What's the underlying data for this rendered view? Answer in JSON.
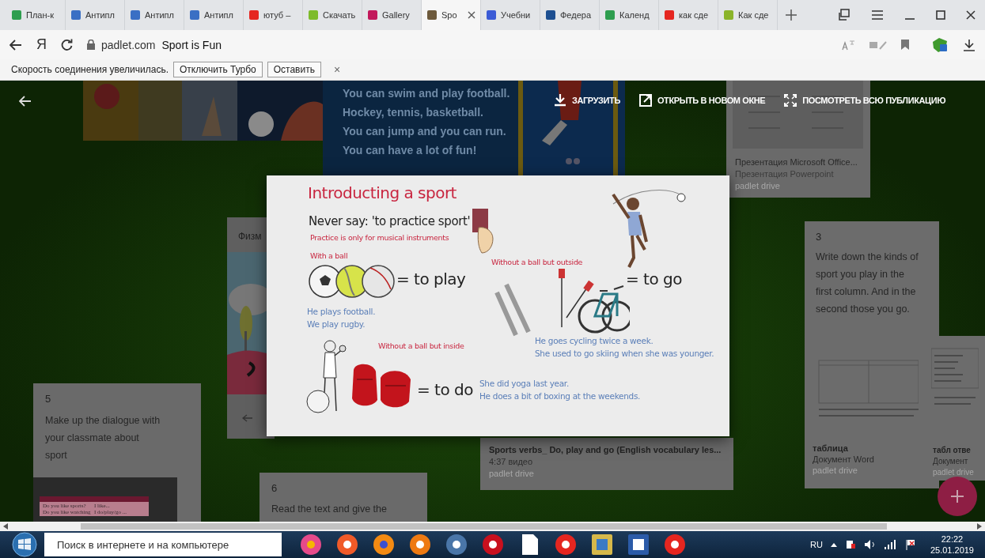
{
  "browser": {
    "tabs": [
      {
        "label": "План-к",
        "selected": false,
        "color": "#2e9e4f"
      },
      {
        "label": "Антипл",
        "selected": false,
        "color": "#3a6fc4"
      },
      {
        "label": "Антипл",
        "selected": false,
        "color": "#3a6fc4"
      },
      {
        "label": "Антипл",
        "selected": false,
        "color": "#3a6fc4"
      },
      {
        "label": "ютуб –",
        "selected": false,
        "color": "#e52620"
      },
      {
        "label": "Скачать",
        "selected": false,
        "color": "#7dbb2a"
      },
      {
        "label": "Gallery",
        "selected": false,
        "color": "#c2185b"
      },
      {
        "label": "Spo",
        "selected": true,
        "color": "#6d5a3c"
      },
      {
        "label": "Учебни",
        "selected": false,
        "color": "#3b5bd6"
      },
      {
        "label": "Федера",
        "selected": false,
        "color": "#1d4f91"
      },
      {
        "label": "Календ",
        "selected": false,
        "color": "#2e9e4f"
      },
      {
        "label": "как сде",
        "selected": false,
        "color": "#e52620"
      },
      {
        "label": "Как сде",
        "selected": false,
        "color": "#8bb42a"
      }
    ],
    "home_glyph": "Я",
    "address": {
      "domain": "padlet.com",
      "title": "Sport is Fun"
    },
    "notification": {
      "text": "Скорость соединения увеличилась.",
      "buttons": [
        "Отключить Турбо",
        "Оставить"
      ],
      "close": "×"
    }
  },
  "viewer": {
    "actions": [
      {
        "kind": "download",
        "label": "ЗАГРУЗИТЬ"
      },
      {
        "kind": "open",
        "label": "ОТКРЫТЬ В НОВОМ ОКНЕ"
      },
      {
        "kind": "fullscreen",
        "label": "ПОСМОТРЕТЬ ВСЮ ПУБЛИКАЦИЮ"
      }
    ]
  },
  "slide": {
    "title": "Introducting a sport",
    "rule": "Never say: 'to practice sport'",
    "note": "Practice is only for musical instruments",
    "groups": [
      {
        "label": "With a ball",
        "verb": "= to play",
        "examples": [
          "He plays football.",
          "We play rugby."
        ]
      },
      {
        "label": "Without a ball but outside",
        "verb": "= to go",
        "examples": [
          "He goes cycling twice a week.",
          "She used to go skiing when she was younger."
        ]
      },
      {
        "label": "Without a ball but inside",
        "verb": "= to do",
        "examples": [
          "She did yoga last year.",
          "He does a bit of boxing at the weekends."
        ]
      }
    ]
  },
  "board": {
    "poem": [
      "You can swim and play football.",
      "Hockey, tennis, basketball.",
      "You can jump and you can run.",
      "You can have a lot of fun!"
    ],
    "presentation_card": {
      "title": "Презентация Microsoft Office...",
      "type": "Презентация Powerpoint",
      "source": "padlet drive"
    },
    "physical_card": {
      "title": "Физм"
    },
    "card_5": {
      "number": "5",
      "text": "Make up the dialogue with your classmate about sport",
      "table": [
        [
          "Do you like sports?",
          "I like..."
        ],
        [
          "Do you like watching",
          "I do/play/go ..."
        ]
      ]
    },
    "card_6": {
      "number": "6",
      "text": "Read the text and give the"
    },
    "video_card": {
      "title": "Sports verbs_ Do, play and go (English vocabulary les...",
      "meta": "4:37 видео",
      "source": "padlet drive"
    },
    "card_3": {
      "number": "3",
      "text": "Write down the kinds of sport you play in the first column. And in the second those you go.",
      "file": "таблица",
      "type": "Документ Word",
      "source": "padlet drive"
    },
    "answers_card": {
      "file": "табл отве",
      "type": "Документ",
      "source": "padlet drive"
    }
  },
  "taskbar": {
    "placeholder": "Поиск в интернете и на компьютере",
    "language": "RU",
    "time": "22:22",
    "date": "25.01.2019"
  }
}
